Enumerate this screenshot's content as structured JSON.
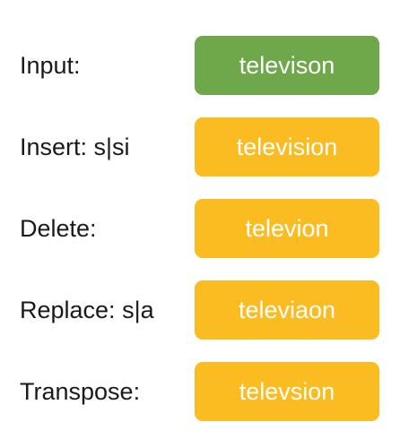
{
  "colors": {
    "input_box": "#6fa84b",
    "candidate_box": "#fbbc22",
    "box_text": "#ffffff",
    "label_text": "#1a1a1a"
  },
  "rows": [
    {
      "label": "Input:",
      "word": "televison",
      "kind": "input"
    },
    {
      "label": "Insert: s|si",
      "word": "television",
      "kind": "candidate"
    },
    {
      "label": "Delete:",
      "word": "televion",
      "kind": "candidate"
    },
    {
      "label": "Replace: s|a",
      "word": "televiaon",
      "kind": "candidate"
    },
    {
      "label": "Transpose:",
      "word": "televsion",
      "kind": "candidate"
    }
  ]
}
